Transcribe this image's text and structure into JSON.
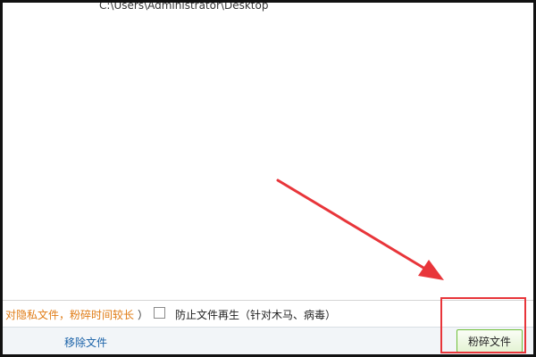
{
  "file_list": {
    "path": "C:\\Users\\Administrator\\Desktop"
  },
  "options": {
    "private_note": "对隐私文件，粉碎时间较长",
    "private_note_close": "）",
    "prevent_regen_label": "防止文件再生（针对木马、病毒）",
    "prevent_regen_checked": false
  },
  "bottom": {
    "remove_files": "移除文件",
    "shred_button": "粉碎文件"
  },
  "annotation": {
    "color": "#e8353a"
  }
}
